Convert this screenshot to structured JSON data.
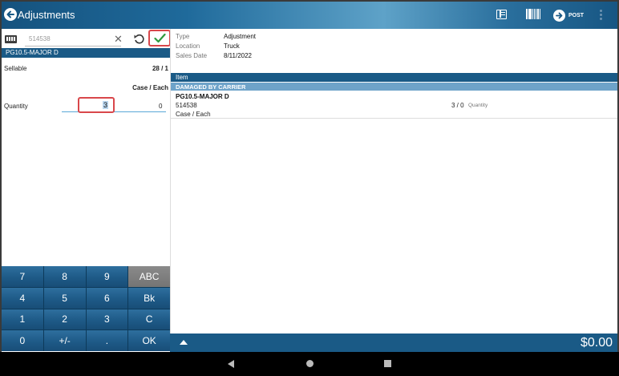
{
  "header": {
    "title": "Adjustments",
    "post_label": "POST",
    "icons": [
      "back-arrow-icon",
      "list-view-icon",
      "barcode-icon",
      "post-arrow-icon",
      "more-vertical-icon"
    ]
  },
  "left": {
    "search": {
      "value": "514538"
    },
    "product_name": "PG10.5-MAJOR D",
    "sellable_label": "Sellable",
    "sellable_value": "28 / 1",
    "uom": "Case / Each",
    "quantity_label": "Quantity",
    "quantity_value": "3",
    "quantity_secondary": "0"
  },
  "keypad": {
    "keys": [
      "7",
      "8",
      "9",
      "ABC",
      "4",
      "5",
      "6",
      "Bk",
      "1",
      "2",
      "3",
      "C",
      "0",
      "+/-",
      ".",
      "OK"
    ]
  },
  "right": {
    "meta": [
      {
        "label": "Type",
        "value": "Adjustment"
      },
      {
        "label": "Location",
        "value": "Truck"
      },
      {
        "label": "Sales Date",
        "value": "8/11/2022"
      }
    ],
    "item_header": "Item",
    "group_header": "DAMAGED BY CARRIER",
    "item": {
      "name": "PG10.5-MAJOR D",
      "sku": "514538",
      "uom": "Case / Each",
      "qty": "3 / 0",
      "qty_label": "Quantity"
    }
  },
  "footer": {
    "total": "$0.00"
  },
  "colors": {
    "primary": "#1a5a86",
    "accent_red": "#d9474b",
    "group_header": "#6ea3c9",
    "confirm_green": "#2e9a3e"
  }
}
